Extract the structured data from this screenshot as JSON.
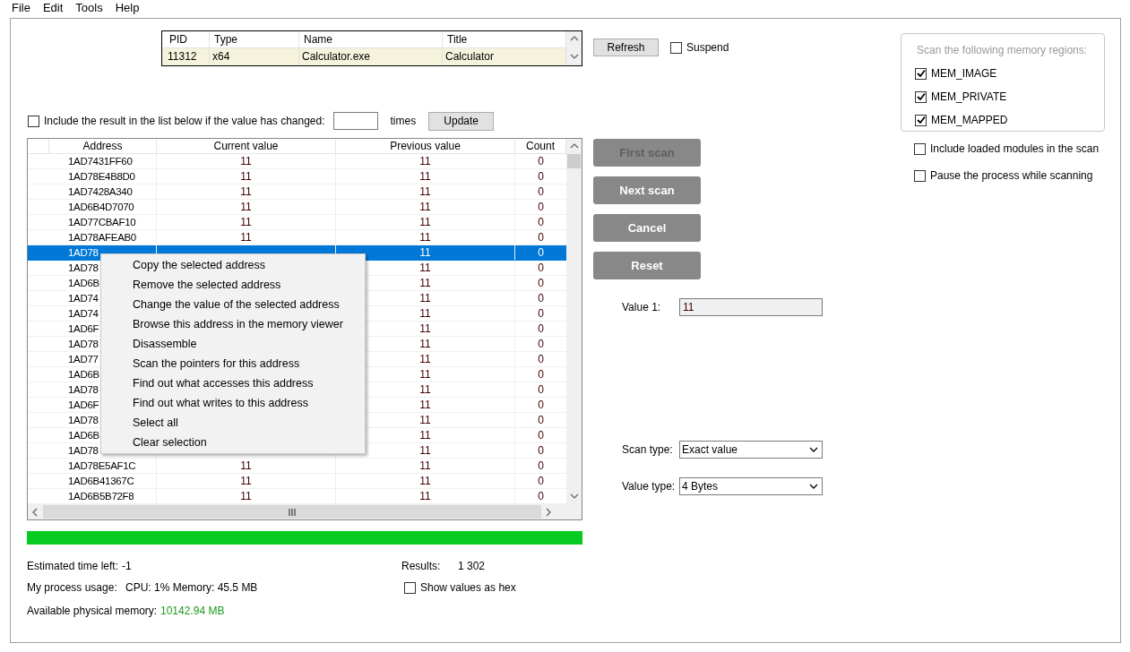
{
  "menu_bar": [
    "File",
    "Edit",
    "Tools",
    "Help"
  ],
  "process_table": {
    "columns": [
      "PID",
      "Type",
      "Name",
      "Title"
    ],
    "rows": [
      {
        "cells": [
          "11312",
          "x64",
          "Calculator.exe",
          "Calculator"
        ]
      }
    ]
  },
  "refresh_button": "Refresh",
  "suspend": {
    "label": "Suspend",
    "checked": false
  },
  "change_filter": {
    "label": "Include the result in the list below if the value has changed:",
    "checked": false,
    "unit": "times",
    "button": "Update"
  },
  "memory_regions": {
    "title": "Scan the following memory regions:",
    "items": [
      {
        "label": "MEM_IMAGE",
        "checked": true
      },
      {
        "label": "MEM_PRIVATE",
        "checked": true
      },
      {
        "label": "MEM_MAPPED",
        "checked": true
      }
    ]
  },
  "options": [
    {
      "label": "Include loaded modules in the scan",
      "checked": false
    },
    {
      "label": "Pause the process while scanning",
      "checked": false
    }
  ],
  "results_table": {
    "columns": [
      "Address",
      "Current value",
      "Previous value",
      "Count"
    ],
    "rows": [
      {
        "address": "1AD7431FF60",
        "current": "11",
        "previous": "11",
        "count": "0",
        "selected": false
      },
      {
        "address": "1AD78E4B8D0",
        "current": "11",
        "previous": "11",
        "count": "0",
        "selected": false
      },
      {
        "address": "1AD7428A340",
        "current": "11",
        "previous": "11",
        "count": "0",
        "selected": false
      },
      {
        "address": "1AD6B4D7070",
        "current": "11",
        "previous": "11",
        "count": "0",
        "selected": false
      },
      {
        "address": "1AD77CBAF10",
        "current": "11",
        "previous": "11",
        "count": "0",
        "selected": false
      },
      {
        "address": "1AD78AFEAB0",
        "current": "11",
        "previous": "11",
        "count": "0",
        "selected": false
      },
      {
        "address": "1AD78",
        "previous": "11",
        "count": "0",
        "selected": true
      },
      {
        "address": "1AD78",
        "previous": "11",
        "count": "0",
        "selected": false
      },
      {
        "address": "1AD6B",
        "previous": "11",
        "count": "0",
        "selected": false
      },
      {
        "address": "1AD74",
        "previous": "11",
        "count": "0",
        "selected": false
      },
      {
        "address": "1AD74",
        "previous": "11",
        "count": "0",
        "selected": false
      },
      {
        "address": "1AD6F",
        "previous": "11",
        "count": "0",
        "selected": false
      },
      {
        "address": "1AD78",
        "previous": "11",
        "count": "0",
        "selected": false
      },
      {
        "address": "1AD77",
        "previous": "11",
        "count": "0",
        "selected": false
      },
      {
        "address": "1AD6B",
        "previous": "11",
        "count": "0",
        "selected": false
      },
      {
        "address": "1AD78",
        "previous": "11",
        "count": "0",
        "selected": false
      },
      {
        "address": "1AD6F",
        "previous": "11",
        "count": "0",
        "selected": false
      },
      {
        "address": "1AD78",
        "previous": "11",
        "count": "0",
        "selected": false
      },
      {
        "address": "1AD6B",
        "previous": "11",
        "count": "0",
        "selected": false
      },
      {
        "address": "1AD78",
        "previous": "11",
        "count": "0",
        "selected": false
      },
      {
        "address": "1AD78E5AF1C",
        "current": "11",
        "previous": "11",
        "count": "0",
        "selected": false
      },
      {
        "address": "1AD6B41367C",
        "current": "11",
        "previous": "11",
        "count": "0",
        "selected": false
      },
      {
        "address": "1AD6B5B72F8",
        "current": "11",
        "previous": "11",
        "count": "0",
        "selected": false
      }
    ]
  },
  "context_menu": [
    "Copy the selected address",
    "Remove the selected address",
    "Change the value of the selected address",
    "Browse this address in the memory viewer",
    "Disassemble",
    "Scan the pointers for this address",
    "Find out what accesses this address",
    "Find out what writes to this address",
    "Select all",
    "Clear selection"
  ],
  "progress": {
    "level": 1
  },
  "scan_buttons": [
    {
      "label": "First scan",
      "disabled": true
    },
    {
      "label": "Next scan",
      "disabled": false
    },
    {
      "label": "Cancel",
      "disabled": false
    },
    {
      "label": "Reset",
      "disabled": false
    }
  ],
  "value_1": {
    "label": "Value 1:",
    "value": "11"
  },
  "scan_type": {
    "label": "Scan type:",
    "value": "Exact value"
  },
  "value_type": {
    "label": "Value type:",
    "value": "4 Bytes"
  },
  "status": {
    "estimated_label": "Estimated time left:",
    "estimated_value": "-1",
    "results_label": "Results:",
    "results_value": "1 302",
    "usage_label": "My process usage:",
    "usage_value": "CPU: 1% Memory: 45.5 MB",
    "hex": {
      "label": "Show values as hex",
      "checked": false
    },
    "memory_label": "Available physical memory:",
    "memory_value": "10142.94 MB"
  }
}
